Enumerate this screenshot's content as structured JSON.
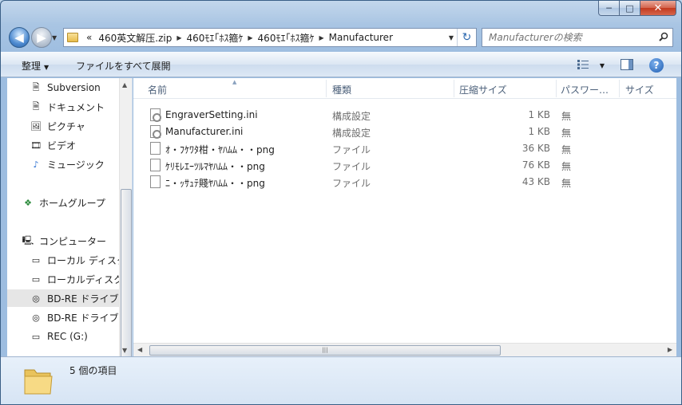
{
  "window": {
    "minimize_label": "─",
    "maximize_label": "□",
    "close_label": "✕"
  },
  "address": {
    "overflow_label": "«",
    "crumbs": [
      "460英文解压.zip",
      "460ﾓｴ｢ﾎｽ箍ｹ",
      "460ﾓｴ｢ﾎｽ箍ｹ",
      "Manufacturer"
    ]
  },
  "search": {
    "placeholder": "Manufacturerの検索"
  },
  "toolbar": {
    "organize_label": "整理",
    "extract_all_label": "ファイルをすべて展開"
  },
  "nav": {
    "items": [
      {
        "label": "Subversion",
        "icon": "document-icon"
      },
      {
        "label": "ドキュメント",
        "icon": "document-icon"
      },
      {
        "label": "ピクチャ",
        "icon": "picture-icon"
      },
      {
        "label": "ビデオ",
        "icon": "video-icon"
      },
      {
        "label": "ミュージック",
        "icon": "music-icon"
      },
      {
        "label": "ホームグループ",
        "icon": "homegroup-icon"
      },
      {
        "label": "コンピューター",
        "icon": "computer-icon"
      },
      {
        "label": "ローカル ディスク",
        "icon": "windows-drive-icon"
      },
      {
        "label": "ローカルディスク",
        "icon": "drive-icon"
      },
      {
        "label": "BD-RE ドライブ",
        "icon": "disc-icon"
      },
      {
        "label": "BD-RE ドライブ",
        "icon": "disc-icon"
      },
      {
        "label": "REC (G:)",
        "icon": "drive-icon"
      }
    ]
  },
  "columns": {
    "name": "名前",
    "type": "種類",
    "compressed_size": "圧縮サイズ",
    "password": "パスワー…",
    "size": "サイズ"
  },
  "files": [
    {
      "name": "EngraverSetting.ini",
      "type": "構成設定",
      "size": "1 KB",
      "password": "無",
      "kind": "ini"
    },
    {
      "name": "Manufacturer.ini",
      "type": "構成設定",
      "size": "1 KB",
      "password": "無",
      "kind": "ini"
    },
    {
      "name": "ｵ・ﾌｹﾜﾀ柑・ﾔﾊﾑﾑ・・png",
      "type": "ファイル",
      "size": "36 KB",
      "password": "無",
      "kind": "file"
    },
    {
      "name": "ｹﾘﾓﾚｴｰﾂﾙﾏﾔﾊﾑﾑ・・png",
      "type": "ファイル",
      "size": "76 KB",
      "password": "無",
      "kind": "file"
    },
    {
      "name": "ﾆ・ｯｻｭﾃ賤ﾔﾊﾑﾑ・・png",
      "type": "ファイル",
      "size": "43 KB",
      "password": "無",
      "kind": "file"
    }
  ],
  "status": {
    "item_count": "5 個の項目"
  }
}
